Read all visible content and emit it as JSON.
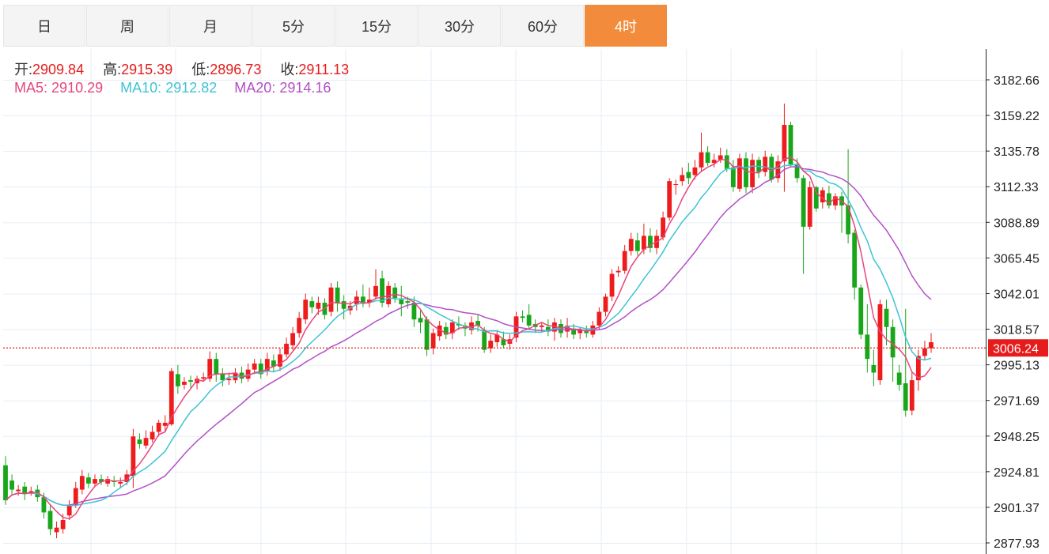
{
  "tabs": [
    {
      "label": "日",
      "active": false
    },
    {
      "label": "周",
      "active": false
    },
    {
      "label": "月",
      "active": false
    },
    {
      "label": "5分",
      "active": false
    },
    {
      "label": "15分",
      "active": false
    },
    {
      "label": "30分",
      "active": false
    },
    {
      "label": "60分",
      "active": false
    },
    {
      "label": "4时",
      "active": true
    }
  ],
  "ohlc_info": {
    "open_label": "开:",
    "open": "2909.84",
    "high_label": "高:",
    "high": "2915.39",
    "low_label": "低:",
    "low": "2896.73",
    "close_label": "收:",
    "close": "2911.13"
  },
  "ma_info": {
    "ma5_label": "MA5:",
    "ma5": "2910.29",
    "ma10_label": "MA10:",
    "ma10": "2912.82",
    "ma20_label": "MA20:",
    "ma20": "2914.16"
  },
  "colors": {
    "up": "#ee1c1c",
    "down": "#1aa61a",
    "ma5": "#e8457a",
    "ma10": "#3fc3d3",
    "ma20": "#b24fc5",
    "accent": "#f28c3c",
    "last_price_bg": "#e61c1c",
    "grid": "#e6eef5"
  },
  "chart_data": {
    "type": "candlestick",
    "y_ticks": [
      3182.66,
      3159.22,
      3135.78,
      3112.33,
      3088.89,
      3065.45,
      3042.01,
      3018.57,
      2995.13,
      2971.69,
      2948.25,
      2924.81,
      2901.37,
      2877.93
    ],
    "y_range": [
      2875,
      3195
    ],
    "last_price": "3006.24",
    "grid": true,
    "candles": [
      [
        2929,
        2906,
        2935,
        2903
      ],
      [
        2919,
        2913,
        2923,
        2910
      ],
      [
        2912,
        2913,
        2916,
        2909
      ],
      [
        2915,
        2910,
        2918,
        2906
      ],
      [
        2911,
        2912,
        2915,
        2909
      ],
      [
        2913,
        2908,
        2916,
        2905
      ],
      [
        2908,
        2898,
        2911,
        2894
      ],
      [
        2899,
        2887,
        2903,
        2883
      ],
      [
        2885,
        2888,
        2892,
        2881
      ],
      [
        2887,
        2893,
        2897,
        2884
      ],
      [
        2896,
        2903,
        2906,
        2893
      ],
      [
        2903,
        2914,
        2918,
        2901
      ],
      [
        2913,
        2922,
        2926,
        2910
      ],
      [
        2921,
        2917,
        2924,
        2914
      ],
      [
        2917,
        2920,
        2923,
        2915
      ],
      [
        2920,
        2918,
        2923,
        2916
      ],
      [
        2917,
        2920,
        2922,
        2915
      ],
      [
        2919,
        2918,
        2922,
        2915
      ],
      [
        2917,
        2918,
        2921,
        2914
      ],
      [
        2918,
        2923,
        2926,
        2916
      ],
      [
        2922,
        2948,
        2953,
        2914
      ],
      [
        2946,
        2943,
        2950,
        2940
      ],
      [
        2942,
        2947,
        2952,
        2940
      ],
      [
        2946,
        2951,
        2955,
        2944
      ],
      [
        2951,
        2957,
        2959,
        2948
      ],
      [
        2955,
        2957,
        2962,
        2951
      ],
      [
        2956,
        2991,
        2993,
        2955
      ],
      [
        2989,
        2981,
        2995,
        2976
      ],
      [
        2982,
        2984,
        2987,
        2979
      ],
      [
        2985,
        2984,
        2988,
        2980
      ],
      [
        2983,
        2986,
        2988,
        2979
      ],
      [
        2986,
        2987,
        2990,
        2984
      ],
      [
        2986,
        2999,
        3004,
        2984
      ],
      [
        2999,
        2989,
        3003,
        2984
      ],
      [
        2989,
        2985,
        2993,
        2981
      ],
      [
        2985,
        2986,
        2990,
        2982
      ],
      [
        2985,
        2990,
        2993,
        2983
      ],
      [
        2990,
        2986,
        2994,
        2983
      ],
      [
        2986,
        2992,
        2996,
        2984
      ],
      [
        2992,
        2996,
        2999,
        2989
      ],
      [
        2996,
        2989,
        2999,
        2986
      ],
      [
        2991,
        2999,
        3003,
        2988
      ],
      [
        2998,
        2994,
        3002,
        2991
      ],
      [
        2994,
        3002,
        3006,
        2991
      ],
      [
        3002,
        3009,
        3013,
        3000
      ],
      [
        3008,
        3016,
        3020,
        3005
      ],
      [
        3016,
        3026,
        3030,
        3013
      ],
      [
        3025,
        3038,
        3042,
        3022
      ],
      [
        3037,
        3033,
        3040,
        3029
      ],
      [
        3032,
        3036,
        3040,
        3028
      ],
      [
        3036,
        3028,
        3039,
        3025
      ],
      [
        3030,
        3046,
        3049,
        3027
      ],
      [
        3046,
        3036,
        3050,
        3030
      ],
      [
        3037,
        3032,
        3041,
        3025
      ],
      [
        3031,
        3034,
        3037,
        3028
      ],
      [
        3035,
        3040,
        3044,
        3031
      ],
      [
        3040,
        3036,
        3048,
        3033
      ],
      [
        3036,
        3038,
        3046,
        3033
      ],
      [
        3040,
        3047,
        3058,
        3038
      ],
      [
        3052,
        3036,
        3057,
        3033
      ],
      [
        3035,
        3047,
        3050,
        3033
      ],
      [
        3046,
        3039,
        3049,
        3036
      ],
      [
        3038,
        3035,
        3047,
        3027
      ],
      [
        3037,
        3036,
        3040,
        3032
      ],
      [
        3036,
        3025,
        3040,
        3020
      ],
      [
        3026,
        3023,
        3031,
        3016
      ],
      [
        3025,
        3005,
        3027,
        3001
      ],
      [
        3006,
        3016,
        3019,
        3002
      ],
      [
        3014,
        3021,
        3024,
        3011
      ],
      [
        3020,
        3015,
        3023,
        3012
      ],
      [
        3016,
        3023,
        3025,
        3012
      ],
      [
        3022,
        3021,
        3027,
        3018
      ],
      [
        3021,
        3019,
        3023,
        3014
      ],
      [
        3018,
        3023,
        3027,
        3015
      ],
      [
        3024,
        3021,
        3028,
        3017
      ],
      [
        3018,
        3005,
        3020,
        3003
      ],
      [
        3006,
        3011,
        3015,
        3003
      ],
      [
        3010,
        3015,
        3018,
        3007
      ],
      [
        3012,
        3008,
        3017,
        3006
      ],
      [
        3009,
        3012,
        3015,
        3005
      ],
      [
        3013,
        3027,
        3030,
        3010
      ],
      [
        3027,
        3026,
        3031,
        3023
      ],
      [
        3028,
        3021,
        3035,
        3018
      ],
      [
        3022,
        3020,
        3025,
        3016
      ],
      [
        3020,
        3021,
        3023,
        3017
      ],
      [
        3020,
        3017,
        3025,
        3014
      ],
      [
        3017,
        3023,
        3026,
        3011
      ],
      [
        3022,
        3016,
        3025,
        3013
      ],
      [
        3017,
        3021,
        3026,
        3013
      ],
      [
        3019,
        3015,
        3022,
        3012
      ],
      [
        3016,
        3018,
        3020,
        3012
      ],
      [
        3018,
        3016,
        3021,
        3013
      ],
      [
        3015,
        3021,
        3024,
        3013
      ],
      [
        3021,
        3030,
        3033,
        3018
      ],
      [
        3030,
        3040,
        3042,
        3027
      ],
      [
        3040,
        3055,
        3058,
        3037
      ],
      [
        3056,
        3057,
        3060,
        3053
      ],
      [
        3057,
        3070,
        3074,
        3055
      ],
      [
        3070,
        3078,
        3082,
        3067
      ],
      [
        3077,
        3070,
        3082,
        3067
      ],
      [
        3071,
        3080,
        3088,
        3068
      ],
      [
        3080,
        3072,
        3085,
        3069
      ],
      [
        3072,
        3080,
        3084,
        3068
      ],
      [
        3079,
        3092,
        3096,
        3077
      ],
      [
        3092,
        3116,
        3118,
        3090
      ],
      [
        3114,
        3114,
        3117,
        3107
      ],
      [
        3116,
        3120,
        3125,
        3113
      ],
      [
        3122,
        3118,
        3128,
        3114
      ],
      [
        3120,
        3125,
        3130,
        3117
      ],
      [
        3125,
        3135,
        3148,
        3122
      ],
      [
        3135,
        3128,
        3139,
        3126
      ],
      [
        3128,
        3130,
        3134,
        3125
      ],
      [
        3130,
        3133,
        3138,
        3128
      ],
      [
        3133,
        3124,
        3137,
        3122
      ],
      [
        3125,
        3112,
        3130,
        3109
      ],
      [
        3111,
        3131,
        3134,
        3109
      ],
      [
        3131,
        3112,
        3135,
        3108
      ],
      [
        3112,
        3130,
        3134,
        3108
      ],
      [
        3130,
        3122,
        3132,
        3118
      ],
      [
        3122,
        3132,
        3136,
        3119
      ],
      [
        3132,
        3117,
        3134,
        3115
      ],
      [
        3118,
        3129,
        3133,
        3115
      ],
      [
        3129,
        3153,
        3167,
        3109
      ],
      [
        3153,
        3127,
        3155,
        3125
      ],
      [
        3127,
        3118,
        3131,
        3115
      ],
      [
        3118,
        3086,
        3120,
        3055
      ],
      [
        3086,
        3112,
        3116,
        3084
      ],
      [
        3112,
        3098,
        3113,
        3096
      ],
      [
        3102,
        3110,
        3112,
        3098
      ],
      [
        3108,
        3100,
        3113,
        3098
      ],
      [
        3100,
        3106,
        3108,
        3097
      ],
      [
        3106,
        3100,
        3109,
        3082
      ],
      [
        3100,
        3081,
        3137,
        3075
      ],
      [
        3082,
        3046,
        3084,
        3038
      ],
      [
        3046,
        3015,
        3048,
        3012
      ],
      [
        3015,
        2999,
        3035,
        2990
      ],
      [
        2995,
        2990,
        3005,
        2981
      ],
      [
        2985,
        3035,
        3038,
        2982
      ],
      [
        3032,
        3020,
        3038,
        3008
      ],
      [
        3020,
        3000,
        3025,
        2984
      ],
      [
        2990,
        2982,
        2995,
        2978
      ],
      [
        2983,
        2965,
        3032,
        2961
      ],
      [
        2965,
        2985,
        2990,
        2962
      ],
      [
        2985,
        3001,
        3005,
        2978
      ],
      [
        3001,
        3006,
        3011,
        2998
      ],
      [
        3006,
        3010,
        3016,
        3003
      ]
    ]
  }
}
